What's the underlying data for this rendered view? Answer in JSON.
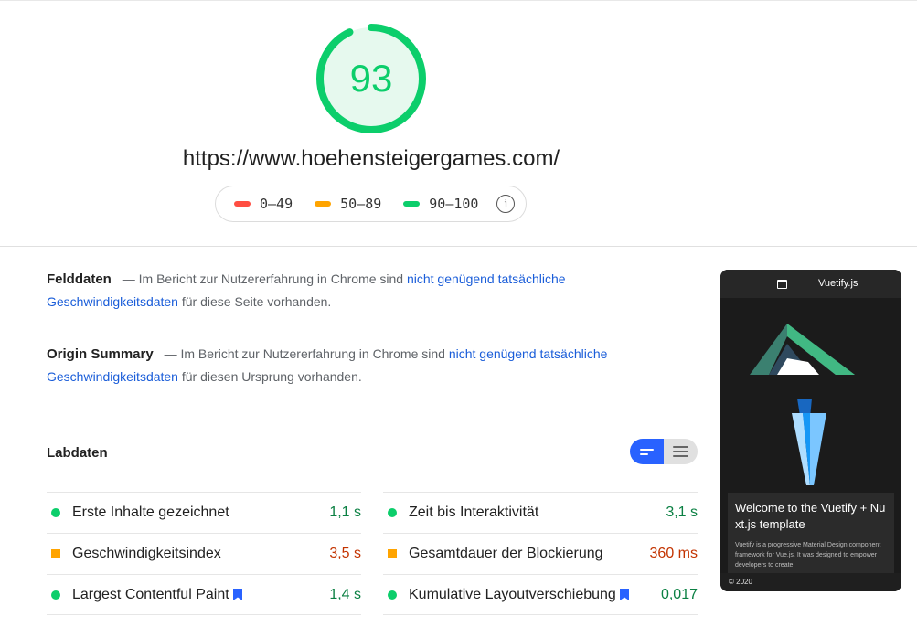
{
  "header": {
    "score": "93",
    "score_fraction": 0.93,
    "url": "https://www.hoehensteigergames.com/",
    "legend": [
      {
        "label": "0–49",
        "color": "#ff4e42"
      },
      {
        "label": "50–89",
        "color": "#ffa400"
      },
      {
        "label": "90–100",
        "color": "#0cce6b"
      }
    ],
    "info_icon": "info-icon"
  },
  "field_data": {
    "title": "Felddaten",
    "prefix": "— Im Bericht zur Nutzererfahrung in Chrome sind ",
    "link": "nicht genügend tatsächliche Geschwindigkeitsdaten",
    "suffix": " für diese Seite vorhanden."
  },
  "origin_summary": {
    "title": "Origin Summary",
    "prefix": "— Im Bericht zur Nutzererfahrung in Chrome sind ",
    "link": "nicht genügend tatsächliche Geschwindigkeitsdaten",
    "suffix": " für diesen Ursprung vorhanden."
  },
  "lab": {
    "title": "Labdaten",
    "left": [
      {
        "label": "Erste Inhalte gezeichnet",
        "value": "1,1 s",
        "status": "pass"
      },
      {
        "label": "Geschwindigkeitsindex",
        "value": "3,5 s",
        "status": "average"
      },
      {
        "label": "Largest Contentful Paint",
        "value": "1,4 s",
        "status": "pass"
      }
    ],
    "right": [
      {
        "label": "Zeit bis Interaktivität",
        "value": "3,1 s",
        "status": "pass"
      },
      {
        "label": "Gesamtdauer der Blockierung",
        "value": "360 ms",
        "status": "average"
      },
      {
        "label": "Kumulative Layoutverschiebung",
        "value": "0,017",
        "status": "pass"
      }
    ]
  },
  "screenshot": {
    "bar_title": "Vuetify.js",
    "card_title": "Welcome to the Vuetify + Nuxt.js template",
    "card_text": "Vuetify is a progressive Material Design component framework for Vue.js. It was designed to empower developers to create",
    "footer": "© 2020"
  },
  "colors": {
    "pass": "#0cce6b",
    "average": "#ffa400",
    "fail": "#ff4e42",
    "link": "#1a5dd9",
    "toggle_active": "#2962ff"
  }
}
